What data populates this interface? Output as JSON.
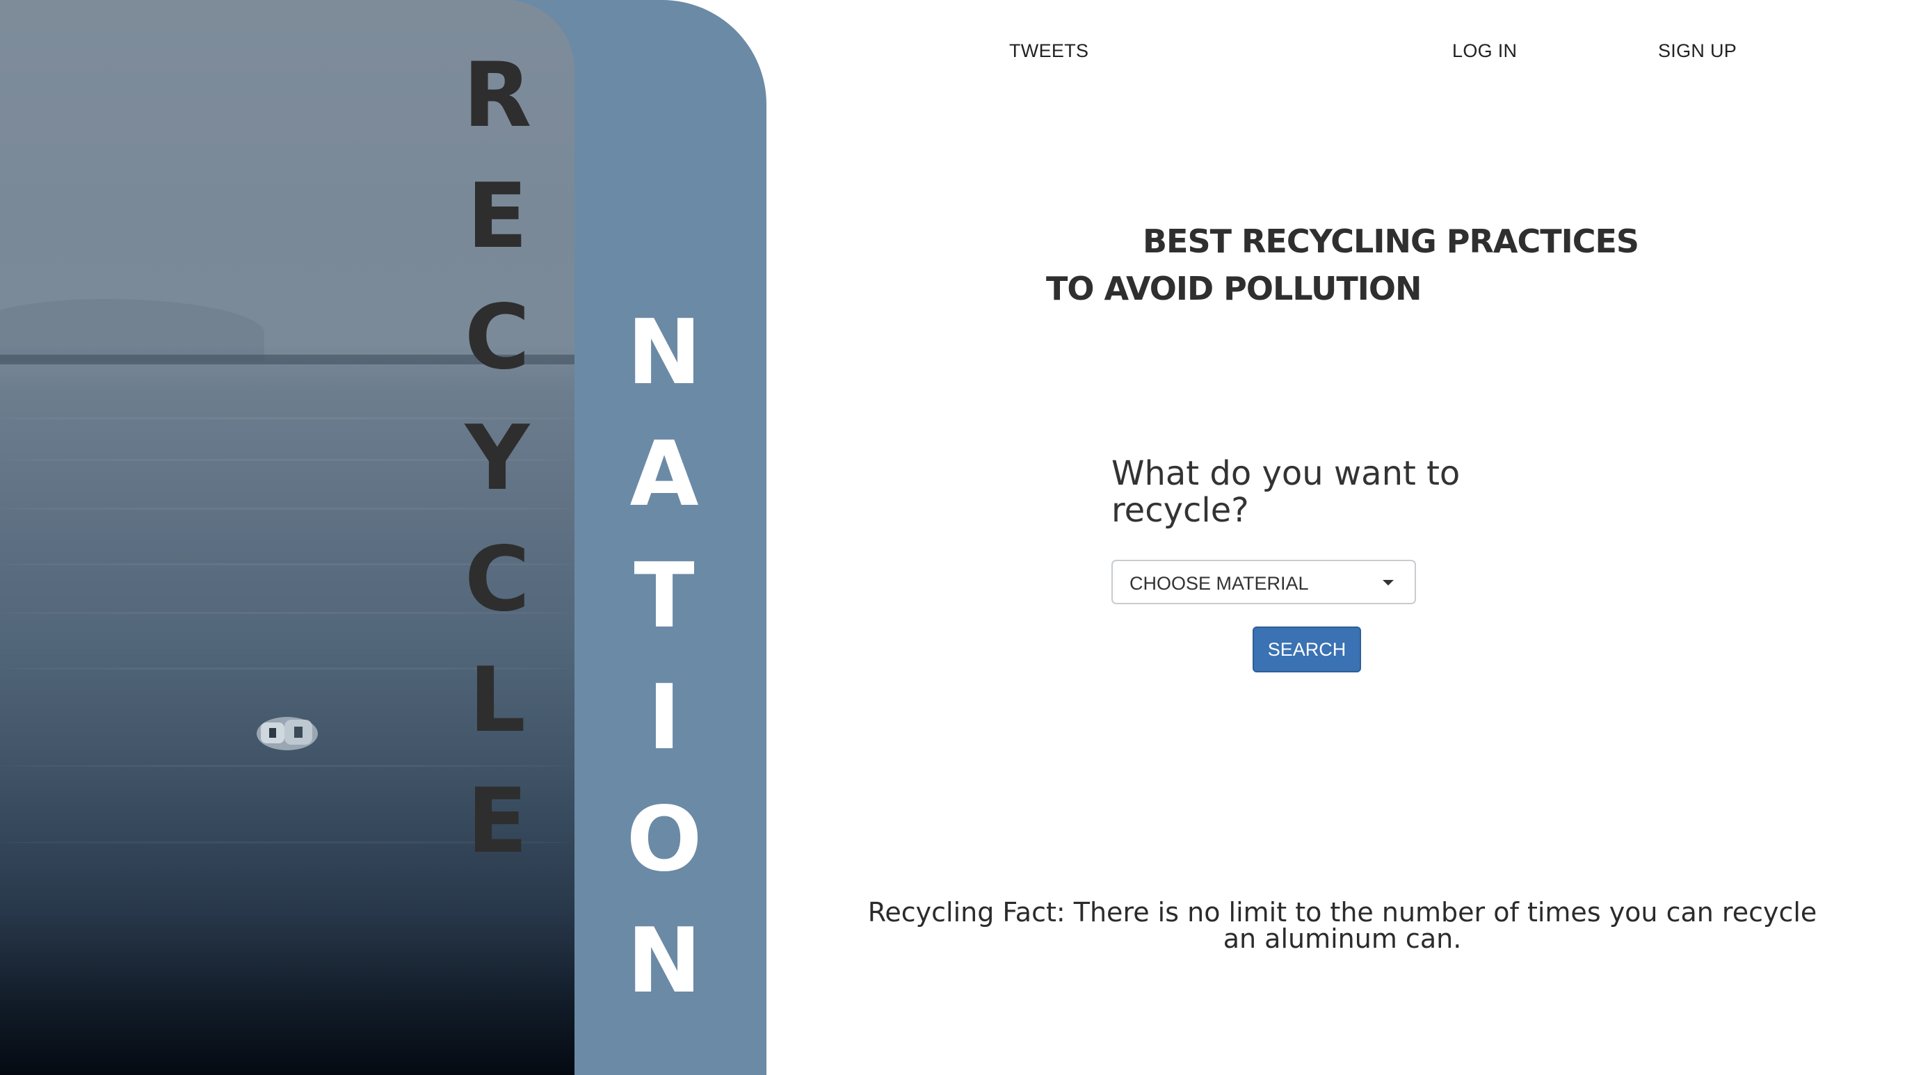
{
  "brand": {
    "word_left": [
      "R",
      "E",
      "C",
      "Y",
      "C",
      "L",
      "E"
    ],
    "word_right": [
      "N",
      "A",
      "T",
      "I",
      "O",
      "N"
    ]
  },
  "nav": {
    "tweets": "TWEETS",
    "login": "LOG IN",
    "signup": "SIGN UP"
  },
  "headline": {
    "line1": "BEST RECYCLING PRACTICES",
    "line2": "TO AVOID POLLUTION"
  },
  "search": {
    "question": "What do you want to recycle?",
    "material_select": "CHOOSE MATERIAL",
    "button": "SEARCH"
  },
  "fact": {
    "text": "Recycling Fact: There is no limit to the number of times you can recycle an aluminum can."
  },
  "colors": {
    "panel_blue": "#6b8aa6",
    "button_blue": "#3a72b3",
    "text_dark": "#2f2f2f"
  }
}
